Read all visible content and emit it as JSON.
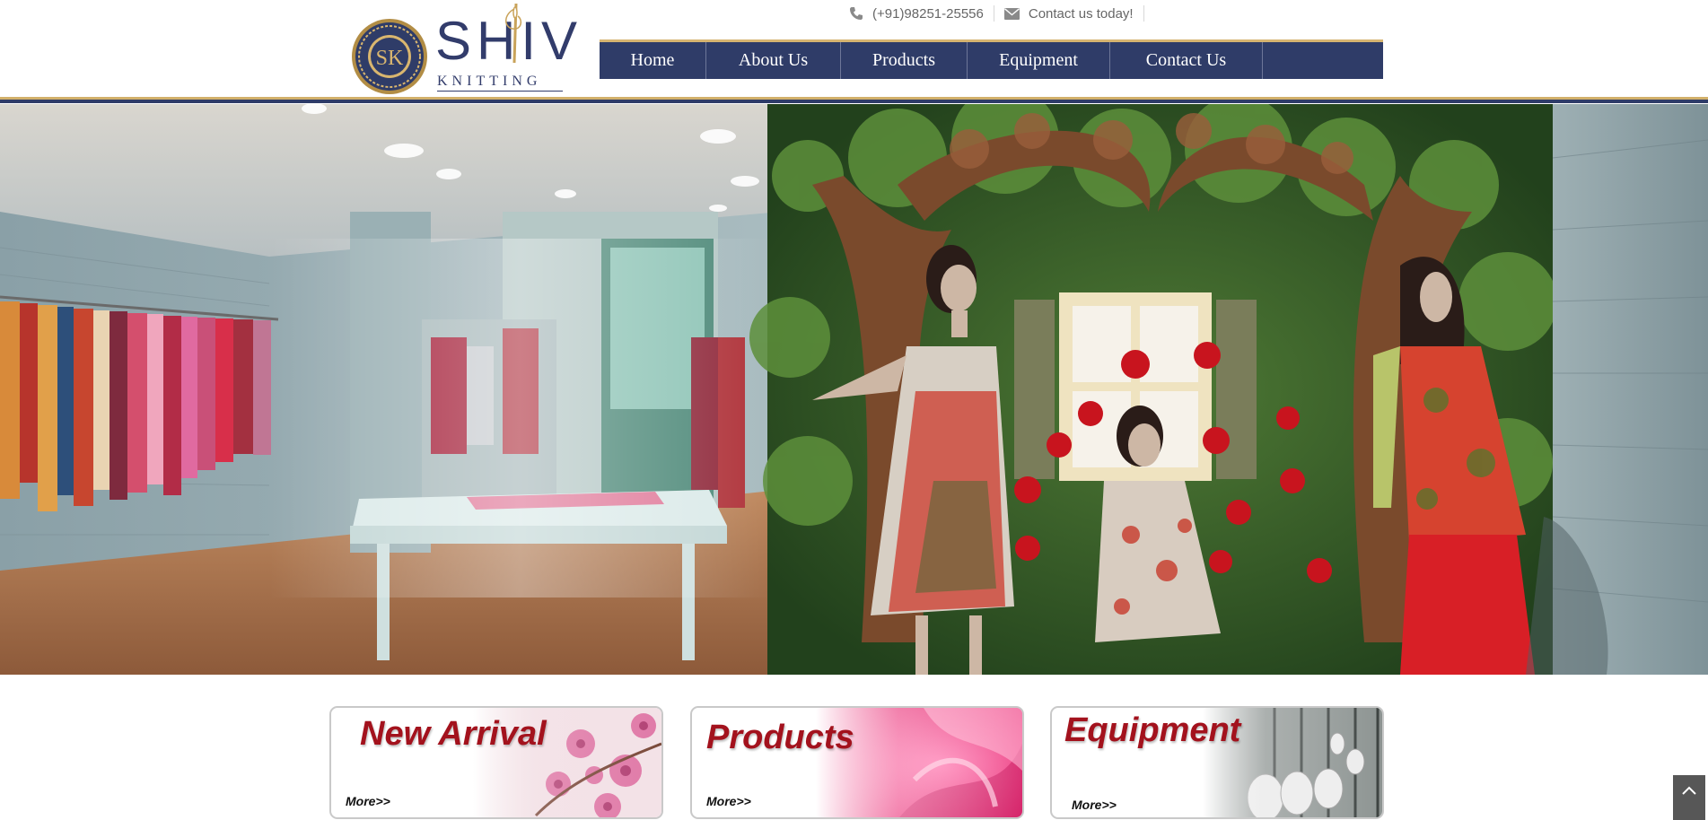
{
  "brand": {
    "seal_letters": "SK",
    "wordmark": "SHIV",
    "subtitle": "KNITTING"
  },
  "topbar": {
    "phone_icon": "phone-icon",
    "phone": "(+91)98251-25556",
    "mail_icon": "envelope-icon",
    "contact_label": "Contact us today!"
  },
  "nav": {
    "items": [
      {
        "label": "Home"
      },
      {
        "label": "About Us"
      },
      {
        "label": "Products"
      },
      {
        "label": "Equipment"
      },
      {
        "label": "Contact Us"
      }
    ]
  },
  "cards": [
    {
      "title": "New Arrival",
      "more": "More>>"
    },
    {
      "title": "Products",
      "more": "More>>"
    },
    {
      "title": "Equipment",
      "more": "More>>"
    }
  ],
  "colors": {
    "navy": "#2f3c68",
    "gold": "#d6b471",
    "card_title_red": "#a3121d"
  },
  "icons": {
    "scroll_top": "chevron-up-icon"
  }
}
